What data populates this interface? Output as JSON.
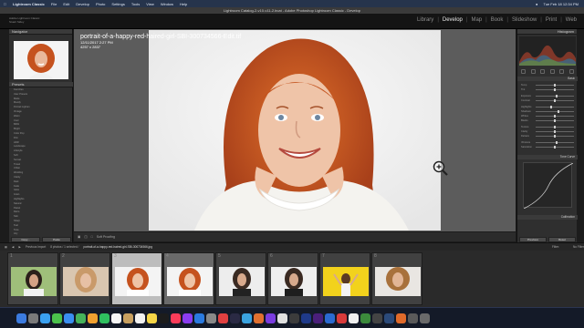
{
  "menubar": {
    "app": "Lightroom Classic",
    "items": [
      "File",
      "Edit",
      "Develop",
      "Photo",
      "Settings",
      "Tools",
      "View",
      "Window",
      "Help"
    ],
    "clock": "Tue Feb 18 12:34 PM"
  },
  "window": {
    "title": "Lightroom Catalog-2-v10-v11-2.lrcat - Adobe Photoshop Lightroom Classic - Develop"
  },
  "identity": {
    "line1": "Adobe Lightroom Classic",
    "line2": "Stuart Sidey"
  },
  "modules": {
    "library": "Library",
    "develop": "Develop",
    "map": "Map",
    "book": "Book",
    "slideshow": "Slideshow",
    "print": "Print",
    "web": "Web"
  },
  "left_panel": {
    "navigator_label": "Navigator",
    "presets_label": "Presets",
    "presets": [
      "Favorites",
      "User Presets",
      "Matte",
      "Moody",
      "Portrait Lighten",
      "Vintage",
      "Warm",
      "Cool",
      "B&W",
      "Bright",
      "Color Pop",
      "Film",
      "HDR",
      "Landscape",
      "Lifestyle",
      "Soft",
      "Sunset",
      "Travel",
      "Urban",
      "Wedding",
      "Clarity",
      "Dark",
      "Fade",
      "Glow",
      "Grain",
      "Highlights",
      "Natural",
      "Pastel",
      "Retro",
      "Skin",
      "Sharp",
      "Teal",
      "Tone",
      "Airy",
      "Auto+"
    ],
    "copy_label": "Copy...",
    "paste_label": "Paste"
  },
  "image": {
    "filename": "portrait-of-a-happy-red-haired-girl-SBI-300734566-Edit.tif",
    "line2": "12/11/2017 2:27 PM",
    "line3": "4257 x 2837"
  },
  "toolbar": {
    "soft_proofing": "Soft Proofing"
  },
  "right_panel": {
    "histogram_label": "Histogram",
    "basic_label": "Basic",
    "tone_curve_label": "Tone Curve",
    "calibration_label": "Calibration",
    "sliders": [
      "Temp",
      "Tint",
      "Exposure",
      "Contrast",
      "Highlights",
      "Shadows",
      "Whites",
      "Blacks",
      "Texture",
      "Clarity",
      "Dehaze",
      "Vibrance",
      "Saturation"
    ],
    "slider_values": [
      0.5,
      0.5,
      0.55,
      0.5,
      0.4,
      0.6,
      0.5,
      0.5,
      0.5,
      0.5,
      0.5,
      0.55,
      0.5
    ],
    "previous_label": "Previous",
    "reset_label": "Reset"
  },
  "filmstrip_bar": {
    "folder": "Previous Import",
    "count": "8 photos / 1 selected /",
    "path": "portrait-of-a-happy-red-haired-girl-SBI-300734566.jpg",
    "filter_label": "Filter:",
    "filter_value": "No Filter"
  },
  "filmstrip": [
    {
      "num": "1"
    },
    {
      "num": "2"
    },
    {
      "num": "3"
    },
    {
      "num": "4"
    },
    {
      "num": "5"
    },
    {
      "num": "6"
    },
    {
      "num": "7"
    },
    {
      "num": "8"
    }
  ],
  "colors": {
    "accent": "#e8e8e8",
    "dock": "#141a28",
    "menubar": "#26344c"
  }
}
